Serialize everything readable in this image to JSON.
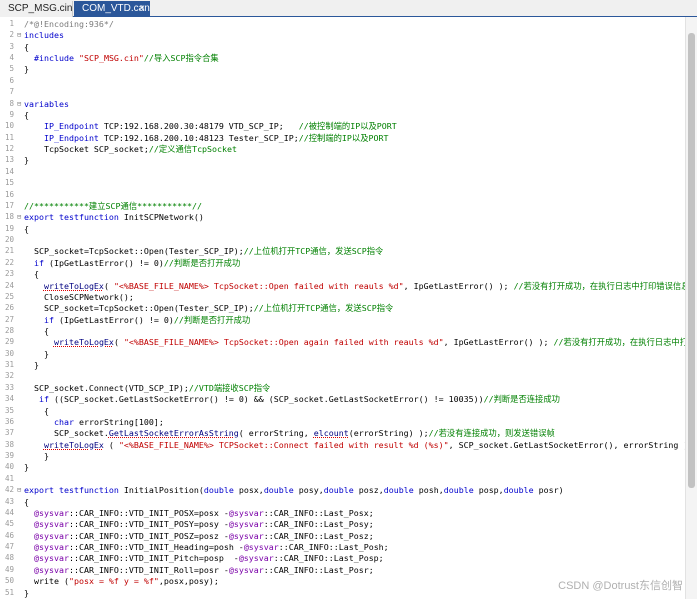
{
  "tabs": [
    {
      "label": "SCP_MSG.cin"
    },
    {
      "label": "COM_VTD.can",
      "close": "×"
    }
  ],
  "watermark": "CSDN @Dotrust东信创智",
  "lines": [
    {
      "n": "1",
      "fold": "",
      "seg": [
        [
          "m",
          "/*@!Encoding:936*/"
        ]
      ]
    },
    {
      "n": "2",
      "fold": "⊟",
      "seg": [
        [
          "k",
          "includes"
        ]
      ]
    },
    {
      "n": "3",
      "fold": "",
      "seg": [
        [
          "",
          "{"
        ]
      ]
    },
    {
      "n": "4",
      "fold": "",
      "seg": [
        [
          "",
          "  "
        ],
        [
          "k",
          "#include "
        ],
        [
          "s",
          "\"SCP_MSG.cin\""
        ],
        [
          "c",
          "//导入SCP指令合集"
        ]
      ]
    },
    {
      "n": "5",
      "fold": "",
      "seg": [
        [
          "",
          "}"
        ]
      ]
    },
    {
      "n": "6",
      "fold": "",
      "seg": []
    },
    {
      "n": "7",
      "fold": "",
      "seg": []
    },
    {
      "n": "8",
      "fold": "⊟",
      "seg": [
        [
          "k",
          "variables"
        ]
      ]
    },
    {
      "n": "9",
      "fold": "",
      "seg": [
        [
          "",
          "{"
        ]
      ]
    },
    {
      "n": "10",
      "fold": "",
      "seg": [
        [
          "",
          "    "
        ],
        [
          "k",
          "IP_Endpoint"
        ],
        [
          "",
          " TCP:192.168.200.30:48179 VTD_SCP_IP;   "
        ],
        [
          "c",
          "//被控制端的IP以及PORT"
        ]
      ]
    },
    {
      "n": "11",
      "fold": "",
      "seg": [
        [
          "",
          "    "
        ],
        [
          "k",
          "IP_Endpoint"
        ],
        [
          "",
          " TCP:192.168.200.10:48123 Tester_SCP_IP;"
        ],
        [
          "c",
          "//控制端的IP以及PORT"
        ]
      ]
    },
    {
      "n": "12",
      "fold": "",
      "seg": [
        [
          "",
          "    TcpSocket SCP_socket;"
        ],
        [
          "c",
          "//定义通信TcpSocket"
        ]
      ]
    },
    {
      "n": "13",
      "fold": "",
      "seg": [
        [
          "",
          "}"
        ]
      ]
    },
    {
      "n": "14",
      "fold": "",
      "seg": []
    },
    {
      "n": "15",
      "fold": "",
      "seg": []
    },
    {
      "n": "16",
      "fold": "",
      "seg": []
    },
    {
      "n": "17",
      "fold": "",
      "seg": [
        [
          "c",
          "//***********建立SCP通信***********//"
        ]
      ]
    },
    {
      "n": "18",
      "fold": "⊟",
      "seg": [
        [
          "k",
          "export testfunction"
        ],
        [
          "",
          " InitSCPNetwork()"
        ]
      ]
    },
    {
      "n": "19",
      "fold": "",
      "seg": [
        [
          "",
          "{"
        ]
      ]
    },
    {
      "n": "20",
      "fold": "",
      "seg": []
    },
    {
      "n": "21",
      "fold": "",
      "seg": [
        [
          "",
          "  SCP_socket=TcpSocket::Open(Tester_SCP_IP);"
        ],
        [
          "c",
          "//上位机打开TCP通信，发送SCP指令"
        ]
      ]
    },
    {
      "n": "22",
      "fold": "",
      "seg": [
        [
          "",
          "  "
        ],
        [
          "k",
          "if"
        ],
        [
          "",
          " (IpGetLastError() != 0)"
        ],
        [
          "c",
          "//判断是否打开成功"
        ]
      ]
    },
    {
      "n": "23",
      "fold": "",
      "seg": [
        [
          "",
          "  {"
        ]
      ]
    },
    {
      "n": "24",
      "fold": "",
      "seg": [
        [
          "",
          "    "
        ],
        [
          "fn",
          "writeToLogEx"
        ],
        [
          "",
          "( "
        ],
        [
          "s",
          "\"<%BASE_FILE_NAME%> TcpSocket::Open failed with reauls %d\""
        ],
        [
          "",
          ", IpGetLastError() ); "
        ],
        [
          "c",
          "//若没有打开成功，在执行日志中打印错误信息"
        ]
      ]
    },
    {
      "n": "25",
      "fold": "",
      "seg": [
        [
          "",
          "    CloseSCPNetwork();"
        ]
      ]
    },
    {
      "n": "26",
      "fold": "",
      "seg": [
        [
          "",
          "    SCP_socket=TcpSocket::Open(Tester_SCP_IP);"
        ],
        [
          "c",
          "//上位机打开TCP通信，发送SCP指令"
        ]
      ]
    },
    {
      "n": "27",
      "fold": "",
      "seg": [
        [
          "",
          "    "
        ],
        [
          "k",
          "if"
        ],
        [
          "",
          " (IpGetLastError() != 0)"
        ],
        [
          "c",
          "//判断是否打开成功"
        ]
      ]
    },
    {
      "n": "28",
      "fold": "",
      "seg": [
        [
          "",
          "    {"
        ]
      ]
    },
    {
      "n": "29",
      "fold": "",
      "seg": [
        [
          "",
          "      "
        ],
        [
          "fn",
          "writeToLogEx"
        ],
        [
          "",
          "( "
        ],
        [
          "s",
          "\"<%BASE_FILE_NAME%> TcpSocket::Open again failed with reauls %d\""
        ],
        [
          "",
          ", IpGetLastError() ); "
        ],
        [
          "c",
          "//若没有打开成功，在执行日志中打印"
        ]
      ]
    },
    {
      "n": "30",
      "fold": "",
      "seg": [
        [
          "",
          "    }"
        ]
      ]
    },
    {
      "n": "31",
      "fold": "",
      "seg": [
        [
          "",
          "  }"
        ]
      ]
    },
    {
      "n": "32",
      "fold": "",
      "seg": []
    },
    {
      "n": "33",
      "fold": "",
      "seg": [
        [
          "",
          "  SCP_socket.Connect(VTD_SCP_IP);"
        ],
        [
          "c",
          "//VTD端接收SCP指令"
        ]
      ]
    },
    {
      "n": "34",
      "fold": "",
      "seg": [
        [
          "",
          "   "
        ],
        [
          "k",
          "if"
        ],
        [
          "",
          " ((SCP_socket.GetLastSocketError() != 0) && (SCP_socket.GetLastSocketError() != 10035))"
        ],
        [
          "c",
          "//判断是否连接成功"
        ]
      ]
    },
    {
      "n": "35",
      "fold": "",
      "seg": [
        [
          "",
          "    {"
        ]
      ]
    },
    {
      "n": "36",
      "fold": "",
      "seg": [
        [
          "",
          "      "
        ],
        [
          "k",
          "char"
        ],
        [
          "",
          " errorString[100];"
        ]
      ]
    },
    {
      "n": "37",
      "fold": "",
      "seg": [
        [
          "",
          "      SCP_socket."
        ],
        [
          "fn",
          "GetLastSocketErrorAsString"
        ],
        [
          "",
          "( errorString, "
        ],
        [
          "fn",
          "elcount"
        ],
        [
          "",
          "(errorString) );"
        ],
        [
          "c",
          "//若没有连接成功，则发送错误帧"
        ]
      ]
    },
    {
      "n": "38",
      "fold": "",
      "seg": [
        [
          "",
          "    "
        ],
        [
          "fn",
          "writeToLogEx"
        ],
        [
          "",
          " ( "
        ],
        [
          "s",
          "\"<%BASE_FILE_NAME%> TCPSocket::Connect failed with result %d (%s)\""
        ],
        [
          "",
          ", SCP_socket.GetLastSocketError(), errorString ); "
        ],
        [
          "c",
          "//若"
        ]
      ]
    },
    {
      "n": "39",
      "fold": "",
      "seg": [
        [
          "",
          "    }"
        ]
      ]
    },
    {
      "n": "40",
      "fold": "",
      "seg": [
        [
          "",
          "}"
        ]
      ]
    },
    {
      "n": "41",
      "fold": "",
      "seg": []
    },
    {
      "n": "42",
      "fold": "⊟",
      "seg": [
        [
          "k",
          "export testfunction"
        ],
        [
          "",
          " InitialPosition("
        ],
        [
          "k",
          "double"
        ],
        [
          "",
          " posx,"
        ],
        [
          "k",
          "double"
        ],
        [
          "",
          " posy,"
        ],
        [
          "k",
          "double"
        ],
        [
          "",
          " posz,"
        ],
        [
          "k",
          "double"
        ],
        [
          "",
          " posh,"
        ],
        [
          "k",
          "double"
        ],
        [
          "",
          " posp,"
        ],
        [
          "k",
          "double"
        ],
        [
          "",
          " posr)"
        ]
      ]
    },
    {
      "n": "43",
      "fold": "",
      "seg": [
        [
          "",
          "{"
        ]
      ]
    },
    {
      "n": "44",
      "fold": "",
      "seg": [
        [
          "",
          "  "
        ],
        [
          "v",
          "@sysvar"
        ],
        [
          "",
          "::CAR_INFO::VTD_INIT_POSX=posx -"
        ],
        [
          "v",
          "@sysvar"
        ],
        [
          "",
          "::CAR_INFO::Last_Posx;"
        ]
      ]
    },
    {
      "n": "45",
      "fold": "",
      "seg": [
        [
          "",
          "  "
        ],
        [
          "v",
          "@sysvar"
        ],
        [
          "",
          "::CAR_INFO::VTD_INIT_POSY=posy -"
        ],
        [
          "v",
          "@sysvar"
        ],
        [
          "",
          "::CAR_INFO::Last_Posy;"
        ]
      ]
    },
    {
      "n": "46",
      "fold": "",
      "seg": [
        [
          "",
          "  "
        ],
        [
          "v",
          "@sysvar"
        ],
        [
          "",
          "::CAR_INFO::VTD_INIT_POSZ=posz -"
        ],
        [
          "v",
          "@sysvar"
        ],
        [
          "",
          "::CAR_INFO::Last_Posz;"
        ]
      ]
    },
    {
      "n": "47",
      "fold": "",
      "seg": [
        [
          "",
          "  "
        ],
        [
          "v",
          "@sysvar"
        ],
        [
          "",
          "::CAR_INFO::VTD_INIT_Heading=posh -"
        ],
        [
          "v",
          "@sysvar"
        ],
        [
          "",
          "::CAR_INFO::Last_Posh;"
        ]
      ]
    },
    {
      "n": "48",
      "fold": "",
      "seg": [
        [
          "",
          "  "
        ],
        [
          "v",
          "@sysvar"
        ],
        [
          "",
          "::CAR_INFO::VTD_INIT_Pitch=posp  -"
        ],
        [
          "v",
          "@sysvar"
        ],
        [
          "",
          "::CAR_INFO::Last_Posp;"
        ]
      ]
    },
    {
      "n": "49",
      "fold": "",
      "seg": [
        [
          "",
          "  "
        ],
        [
          "v",
          "@sysvar"
        ],
        [
          "",
          "::CAR_INFO::VTD_INIT_Roll=posr -"
        ],
        [
          "v",
          "@sysvar"
        ],
        [
          "",
          "::CAR_INFO::Last_Posr;"
        ]
      ]
    },
    {
      "n": "50",
      "fold": "",
      "seg": [
        [
          "",
          "  write ("
        ],
        [
          "s",
          "\"posx = %f y = %f\""
        ],
        [
          "",
          ",posx,posy);"
        ]
      ]
    },
    {
      "n": "51",
      "fold": "",
      "seg": [
        [
          "",
          "}"
        ]
      ]
    },
    {
      "n": "52",
      "fold": "",
      "seg": []
    },
    {
      "n": "53",
      "fold": "",
      "seg": []
    }
  ]
}
